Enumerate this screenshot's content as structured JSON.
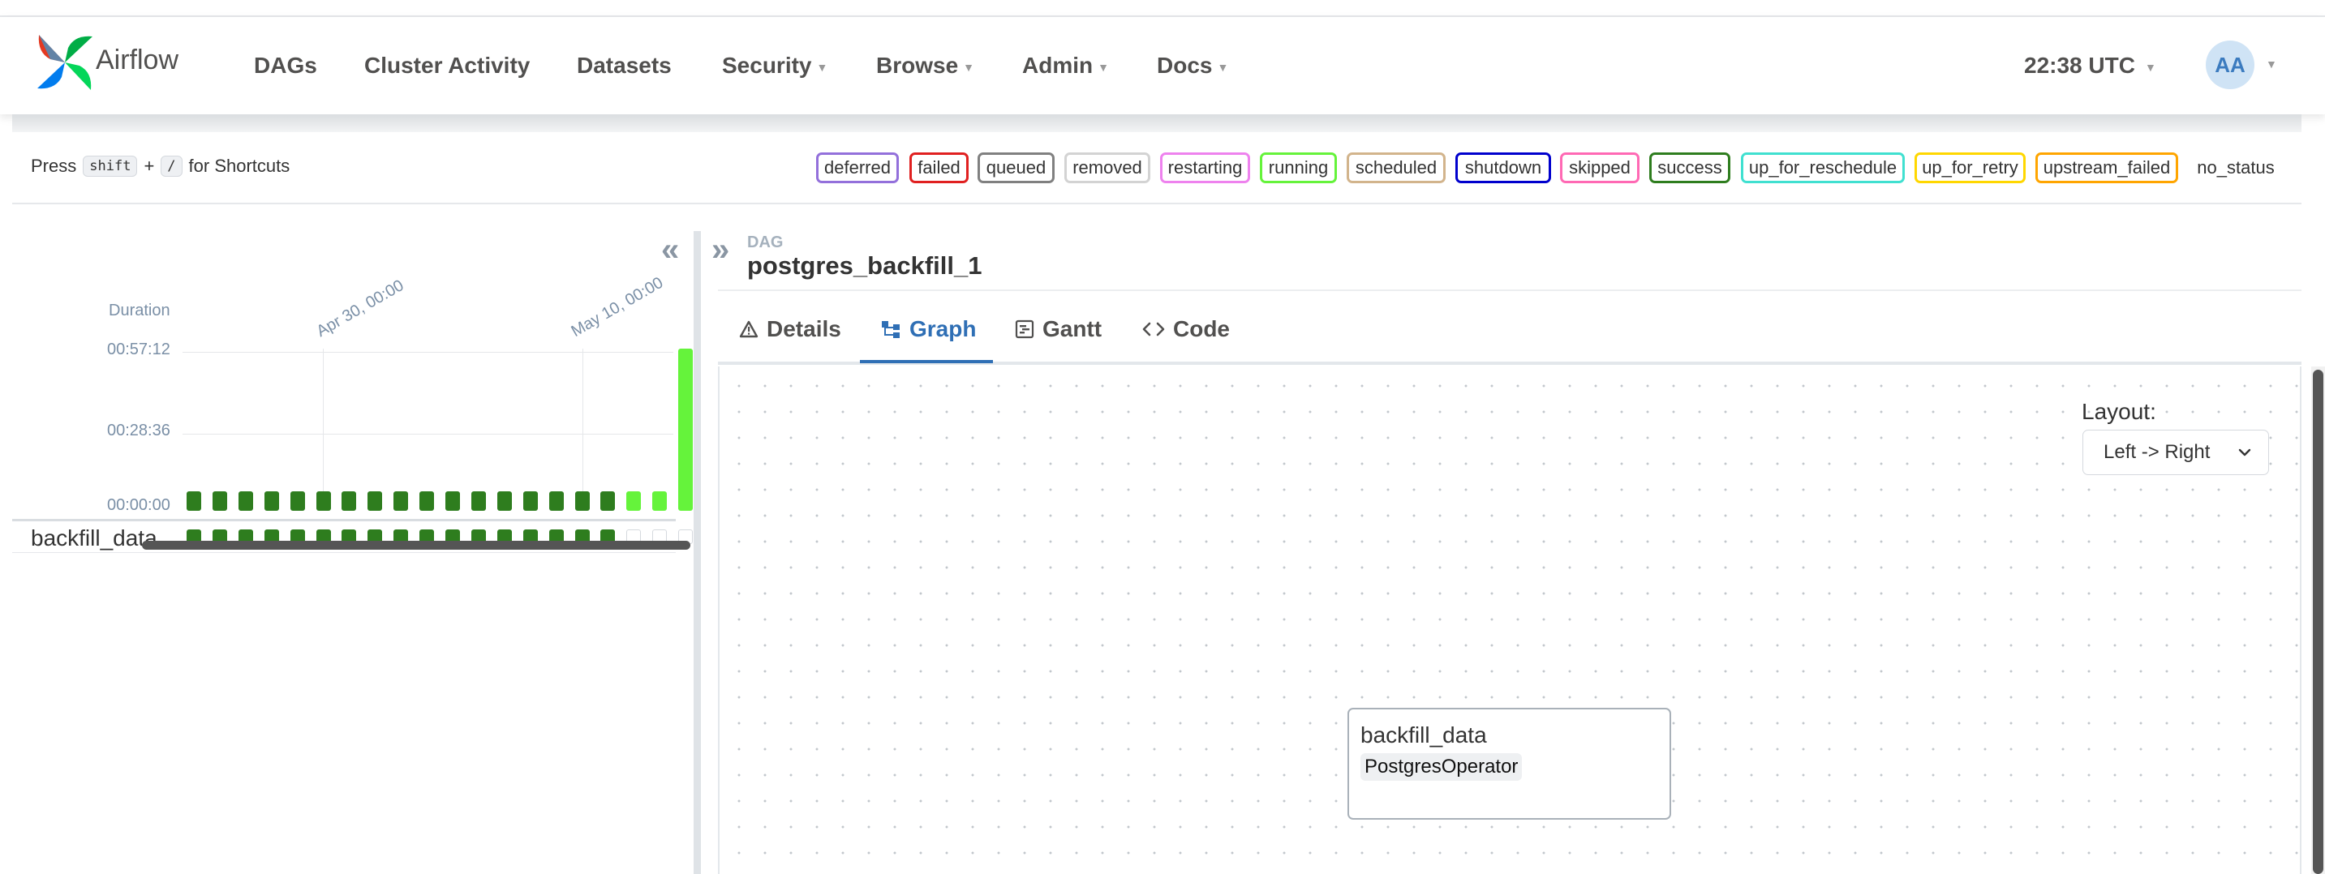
{
  "app": {
    "brand": "Airflow",
    "clock": "22:38 UTC",
    "avatar_initials": "AA"
  },
  "nav": {
    "items": [
      {
        "label": "DAGs",
        "dropdown": false
      },
      {
        "label": "Cluster Activity",
        "dropdown": false
      },
      {
        "label": "Datasets",
        "dropdown": false
      },
      {
        "label": "Security",
        "dropdown": true
      },
      {
        "label": "Browse",
        "dropdown": true
      },
      {
        "label": "Admin",
        "dropdown": true
      },
      {
        "label": "Docs",
        "dropdown": true
      }
    ]
  },
  "shortcuts": {
    "prefix": "Press",
    "key1": "shift",
    "plus": "+",
    "key2": "/",
    "suffix": "for Shortcuts"
  },
  "states": [
    {
      "label": "deferred",
      "color": "#9370db"
    },
    {
      "label": "failed",
      "color": "#e02020"
    },
    {
      "label": "queued",
      "color": "#808080"
    },
    {
      "label": "removed",
      "color": "#d3d3d3"
    },
    {
      "label": "restarting",
      "color": "#ee82ee"
    },
    {
      "label": "running",
      "color": "#65f33b"
    },
    {
      "label": "scheduled",
      "color": "#d2b48c"
    },
    {
      "label": "shutdown",
      "color": "#0000cd"
    },
    {
      "label": "skipped",
      "color": "#ff69b4"
    },
    {
      "label": "success",
      "color": "#2e7d1e"
    },
    {
      "label": "up_for_reschedule",
      "color": "#40e0d0"
    },
    {
      "label": "up_for_retry",
      "color": "#ffd700"
    },
    {
      "label": "upstream_failed",
      "color": "#ffa500"
    },
    {
      "label": "no_status",
      "color": ""
    }
  ],
  "grid": {
    "collapse_icon": "double-chevron-left-icon",
    "duration_label": "Duration",
    "y_ticks": [
      "00:57:12",
      "00:28:36",
      "00:00:00"
    ],
    "date_labels": [
      "Apr 30, 00:00",
      "May 10, 00:00"
    ],
    "task_name": "backfill_data",
    "run_count": 19,
    "run_states": [
      "success",
      "success",
      "success",
      "success",
      "success",
      "success",
      "success",
      "success",
      "success",
      "success",
      "success",
      "success",
      "success",
      "success",
      "success",
      "success",
      "success",
      "running",
      "running"
    ],
    "last_run_state": "running",
    "last_run_duration_fraction": 1.0,
    "task_instance_states": [
      "success",
      "success",
      "success",
      "success",
      "success",
      "success",
      "success",
      "success",
      "success",
      "success",
      "success",
      "success",
      "success",
      "success",
      "success",
      "success",
      "success",
      "no_status",
      "no_status"
    ]
  },
  "dag": {
    "expand_icon": "double-chevron-right-icon",
    "subtitle": "DAG",
    "title": "postgres_backfill_1",
    "tabs": [
      {
        "label": "Details",
        "icon": "warning-triangle-icon"
      },
      {
        "label": "Graph",
        "icon": "graph-icon",
        "active": true
      },
      {
        "label": "Gantt",
        "icon": "gantt-icon"
      },
      {
        "label": "Code",
        "icon": "code-icon"
      }
    ]
  },
  "graph": {
    "layout_label": "Layout:",
    "layout_value": "Left -> Right",
    "node": {
      "task_id": "backfill_data",
      "operator": "PostgresOperator"
    }
  }
}
